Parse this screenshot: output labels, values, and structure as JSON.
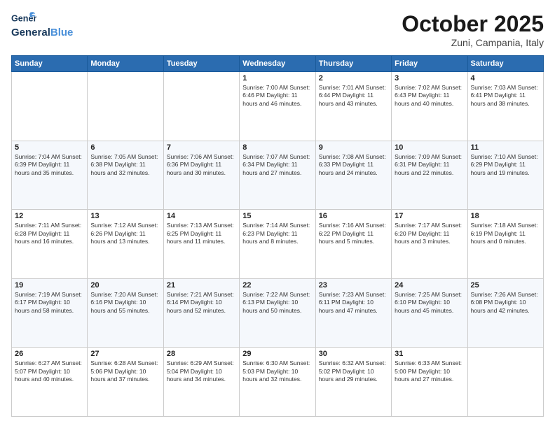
{
  "header": {
    "logo_general": "General",
    "logo_blue": "Blue",
    "month_title": "October 2025",
    "subtitle": "Zuni, Campania, Italy"
  },
  "days_of_week": [
    "Sunday",
    "Monday",
    "Tuesday",
    "Wednesday",
    "Thursday",
    "Friday",
    "Saturday"
  ],
  "weeks": [
    [
      {
        "day": "",
        "info": ""
      },
      {
        "day": "",
        "info": ""
      },
      {
        "day": "",
        "info": ""
      },
      {
        "day": "1",
        "info": "Sunrise: 7:00 AM\nSunset: 6:46 PM\nDaylight: 11 hours\nand 46 minutes."
      },
      {
        "day": "2",
        "info": "Sunrise: 7:01 AM\nSunset: 6:44 PM\nDaylight: 11 hours\nand 43 minutes."
      },
      {
        "day": "3",
        "info": "Sunrise: 7:02 AM\nSunset: 6:43 PM\nDaylight: 11 hours\nand 40 minutes."
      },
      {
        "day": "4",
        "info": "Sunrise: 7:03 AM\nSunset: 6:41 PM\nDaylight: 11 hours\nand 38 minutes."
      }
    ],
    [
      {
        "day": "5",
        "info": "Sunrise: 7:04 AM\nSunset: 6:39 PM\nDaylight: 11 hours\nand 35 minutes."
      },
      {
        "day": "6",
        "info": "Sunrise: 7:05 AM\nSunset: 6:38 PM\nDaylight: 11 hours\nand 32 minutes."
      },
      {
        "day": "7",
        "info": "Sunrise: 7:06 AM\nSunset: 6:36 PM\nDaylight: 11 hours\nand 30 minutes."
      },
      {
        "day": "8",
        "info": "Sunrise: 7:07 AM\nSunset: 6:34 PM\nDaylight: 11 hours\nand 27 minutes."
      },
      {
        "day": "9",
        "info": "Sunrise: 7:08 AM\nSunset: 6:33 PM\nDaylight: 11 hours\nand 24 minutes."
      },
      {
        "day": "10",
        "info": "Sunrise: 7:09 AM\nSunset: 6:31 PM\nDaylight: 11 hours\nand 22 minutes."
      },
      {
        "day": "11",
        "info": "Sunrise: 7:10 AM\nSunset: 6:29 PM\nDaylight: 11 hours\nand 19 minutes."
      }
    ],
    [
      {
        "day": "12",
        "info": "Sunrise: 7:11 AM\nSunset: 6:28 PM\nDaylight: 11 hours\nand 16 minutes."
      },
      {
        "day": "13",
        "info": "Sunrise: 7:12 AM\nSunset: 6:26 PM\nDaylight: 11 hours\nand 13 minutes."
      },
      {
        "day": "14",
        "info": "Sunrise: 7:13 AM\nSunset: 6:25 PM\nDaylight: 11 hours\nand 11 minutes."
      },
      {
        "day": "15",
        "info": "Sunrise: 7:14 AM\nSunset: 6:23 PM\nDaylight: 11 hours\nand 8 minutes."
      },
      {
        "day": "16",
        "info": "Sunrise: 7:16 AM\nSunset: 6:22 PM\nDaylight: 11 hours\nand 5 minutes."
      },
      {
        "day": "17",
        "info": "Sunrise: 7:17 AM\nSunset: 6:20 PM\nDaylight: 11 hours\nand 3 minutes."
      },
      {
        "day": "18",
        "info": "Sunrise: 7:18 AM\nSunset: 6:19 PM\nDaylight: 11 hours\nand 0 minutes."
      }
    ],
    [
      {
        "day": "19",
        "info": "Sunrise: 7:19 AM\nSunset: 6:17 PM\nDaylight: 10 hours\nand 58 minutes."
      },
      {
        "day": "20",
        "info": "Sunrise: 7:20 AM\nSunset: 6:16 PM\nDaylight: 10 hours\nand 55 minutes."
      },
      {
        "day": "21",
        "info": "Sunrise: 7:21 AM\nSunset: 6:14 PM\nDaylight: 10 hours\nand 52 minutes."
      },
      {
        "day": "22",
        "info": "Sunrise: 7:22 AM\nSunset: 6:13 PM\nDaylight: 10 hours\nand 50 minutes."
      },
      {
        "day": "23",
        "info": "Sunrise: 7:23 AM\nSunset: 6:11 PM\nDaylight: 10 hours\nand 47 minutes."
      },
      {
        "day": "24",
        "info": "Sunrise: 7:25 AM\nSunset: 6:10 PM\nDaylight: 10 hours\nand 45 minutes."
      },
      {
        "day": "25",
        "info": "Sunrise: 7:26 AM\nSunset: 6:08 PM\nDaylight: 10 hours\nand 42 minutes."
      }
    ],
    [
      {
        "day": "26",
        "info": "Sunrise: 6:27 AM\nSunset: 5:07 PM\nDaylight: 10 hours\nand 40 minutes."
      },
      {
        "day": "27",
        "info": "Sunrise: 6:28 AM\nSunset: 5:06 PM\nDaylight: 10 hours\nand 37 minutes."
      },
      {
        "day": "28",
        "info": "Sunrise: 6:29 AM\nSunset: 5:04 PM\nDaylight: 10 hours\nand 34 minutes."
      },
      {
        "day": "29",
        "info": "Sunrise: 6:30 AM\nSunset: 5:03 PM\nDaylight: 10 hours\nand 32 minutes."
      },
      {
        "day": "30",
        "info": "Sunrise: 6:32 AM\nSunset: 5:02 PM\nDaylight: 10 hours\nand 29 minutes."
      },
      {
        "day": "31",
        "info": "Sunrise: 6:33 AM\nSunset: 5:00 PM\nDaylight: 10 hours\nand 27 minutes."
      },
      {
        "day": "",
        "info": ""
      }
    ]
  ]
}
